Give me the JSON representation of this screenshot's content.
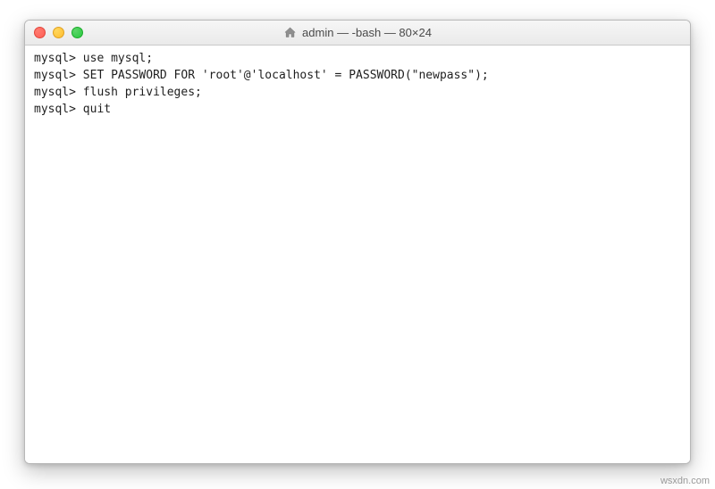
{
  "window": {
    "title": "admin — -bash — 80×24",
    "icon": "home-icon"
  },
  "terminal": {
    "prompt": "mysql>",
    "lines": [
      {
        "prompt": "mysql>",
        "cmd": "use mysql;"
      },
      {
        "prompt": "mysql>",
        "cmd": "SET PASSWORD FOR 'root'@'localhost' = PASSWORD(\"newpass\");"
      },
      {
        "prompt": "mysql>",
        "cmd": "flush privileges;"
      },
      {
        "prompt": "mysql>",
        "cmd": "quit"
      }
    ]
  },
  "watermark": "wsxdn.com"
}
